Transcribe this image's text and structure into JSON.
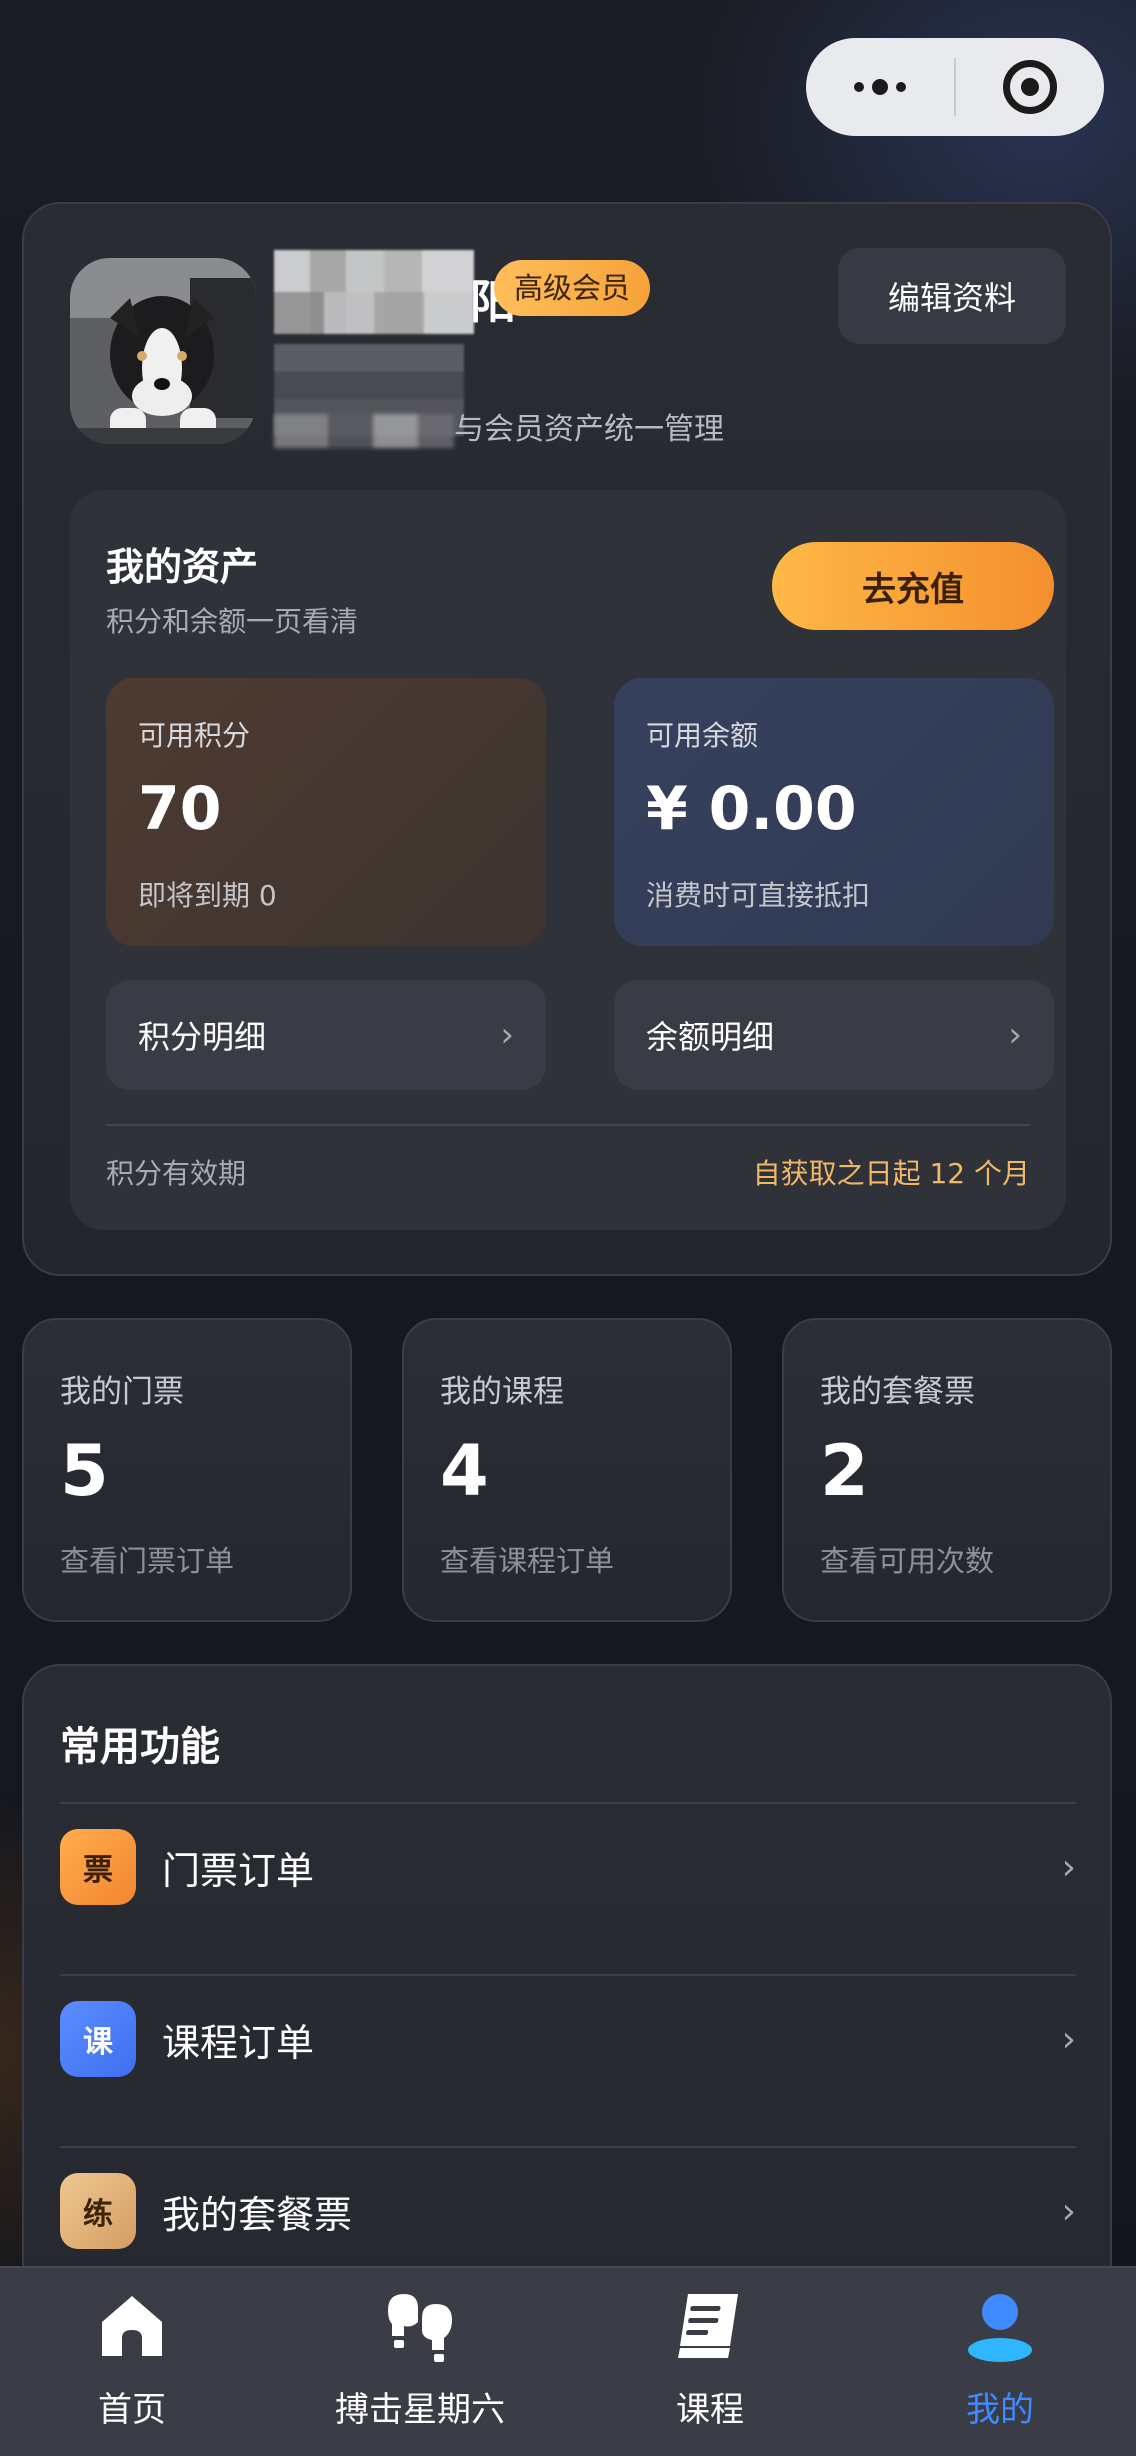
{
  "profile": {
    "username_visible_tail": "阳",
    "vip_label": "高级会员",
    "edit_label": "编辑资料",
    "subtitle_visible": "与会员资产统一管理"
  },
  "assets": {
    "title": "我的资产",
    "subtitle": "积分和余额一页看清",
    "recharge_label": "去充值",
    "points": {
      "label": "可用积分",
      "value": "70",
      "note": "即将到期 0"
    },
    "balance": {
      "label": "可用余额",
      "value": "¥ 0.00",
      "note": "消费时可直接抵扣"
    },
    "points_detail_label": "积分明细",
    "balance_detail_label": "余额明细",
    "validity_label": "积分有效期",
    "validity_value": "自获取之日起 12 个月"
  },
  "stats": [
    {
      "label": "我的门票",
      "value": "5",
      "note": "查看门票订单"
    },
    {
      "label": "我的课程",
      "value": "4",
      "note": "查看课程订单"
    },
    {
      "label": "我的套餐票",
      "value": "2",
      "note": "查看可用次数"
    }
  ],
  "functions": {
    "title": "常用功能",
    "items": [
      {
        "icon_text": "票",
        "label": "门票订单",
        "icon_color": "#f7943a"
      },
      {
        "icon_text": "课",
        "label": "课程订单",
        "icon_color": "#4a7cf7"
      },
      {
        "icon_text": "练",
        "label": "我的套餐票",
        "icon_color": "#d6a66e"
      }
    ]
  },
  "tabbar": {
    "items": [
      {
        "label": "首页",
        "icon": "home-icon"
      },
      {
        "label": "搏击星期六",
        "icon": "boxing-glove-icon"
      },
      {
        "label": "课程",
        "icon": "book-icon"
      },
      {
        "label": "我的",
        "icon": "profile-icon"
      }
    ],
    "active_index": 3,
    "active_color": "#3e8cff"
  },
  "colors": {
    "accent_orange": "#f7a23a",
    "accent_blue": "#3e8cff",
    "gold_text": "#f2b866"
  }
}
